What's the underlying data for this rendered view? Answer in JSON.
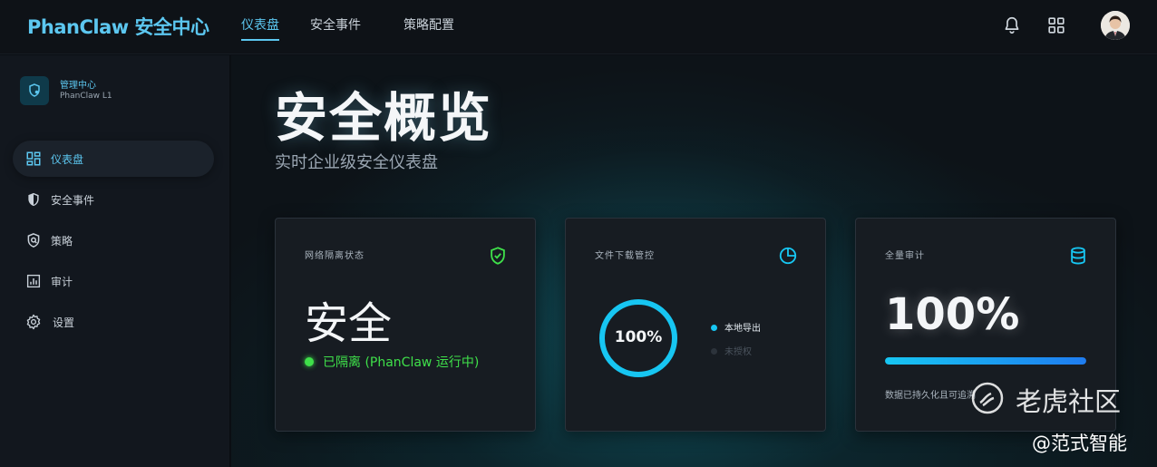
{
  "header": {
    "brand": "PhanClaw 安全中心",
    "tabs": [
      {
        "label": "仪表盘",
        "active": true
      },
      {
        "label": "安全事件",
        "active": false
      },
      {
        "label": "策略配置",
        "active": false
      }
    ],
    "icons": [
      "bell-icon",
      "grid-icon",
      "avatar"
    ]
  },
  "sidebar": {
    "org_name": "管理中心",
    "org_sub": "PhanClaw L1",
    "items": [
      {
        "label": "仪表盘",
        "icon": "dashboard-icon",
        "active": true
      },
      {
        "label": "安全事件",
        "icon": "shield-icon",
        "active": false
      },
      {
        "label": "策略",
        "icon": "policy-icon",
        "active": false
      },
      {
        "label": "审计",
        "icon": "audit-icon",
        "active": false
      },
      {
        "label": "设置",
        "icon": "gear-icon",
        "active": false
      }
    ]
  },
  "main": {
    "title": "安全概览",
    "subtitle": "实时企业级安全仪表盘",
    "cards": {
      "isolation": {
        "label": "网络隔离状态",
        "value": "安全",
        "status": "已隔离 (PhanClaw 运行中)",
        "icon": "shield-check-icon"
      },
      "download": {
        "label": "文件下载管控",
        "ring_value": "100%",
        "ring_fraction": 1.0,
        "legend": [
          {
            "label": "本地导出",
            "color": "#17c6f2"
          },
          {
            "label": "未授权",
            "color": "#3a424b"
          }
        ],
        "icon": "pie-chart-icon"
      },
      "audit": {
        "label": "全量审计",
        "value": "100%",
        "progress_fraction": 1.0,
        "note": "数据已持久化且可追溯",
        "icon": "database-icon"
      }
    }
  },
  "watermarks": {
    "site": "老虎社区",
    "author": "@范式智能"
  },
  "colors": {
    "accent": "#5cc7f0",
    "success": "#3fe04a",
    "ring": "#17c6f2"
  }
}
